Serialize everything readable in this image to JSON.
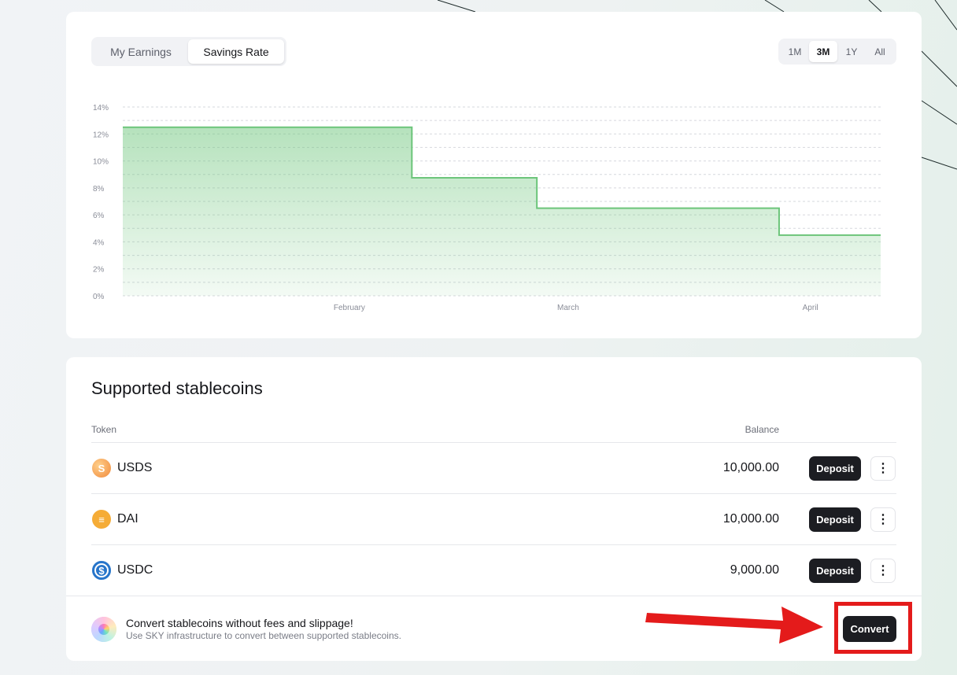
{
  "chart_tabs": {
    "earnings": "My Earnings",
    "savings_rate": "Savings Rate",
    "active": "savings_rate"
  },
  "ranges": [
    "1M",
    "3M",
    "1Y",
    "All"
  ],
  "active_range": "3M",
  "chart_data": {
    "type": "area",
    "step": true,
    "x": [
      "2025-01-03",
      "2025-02-09",
      "2025-02-25",
      "2025-03-28",
      "2025-04-10"
    ],
    "values": [
      12.5,
      8.75,
      6.5,
      4.5,
      4.5
    ],
    "x_ticks": [
      "February",
      "March",
      "April"
    ],
    "y_ticks": [
      "0%",
      "2%",
      "4%",
      "6%",
      "8%",
      "10%",
      "12%",
      "14%"
    ],
    "ylim": [
      0,
      14
    ],
    "grid": true,
    "color": "#6cc57a"
  },
  "stablecoins": {
    "title": "Supported stablecoins",
    "col_token": "Token",
    "col_balance": "Balance",
    "rows": [
      {
        "name": "USDS",
        "balance": "10,000.00",
        "icon": "usds-icon",
        "color": "#f0a14a"
      },
      {
        "name": "DAI",
        "balance": "10,000.00",
        "icon": "dai-icon",
        "color": "#f5ac37"
      },
      {
        "name": "USDC",
        "balance": "9,000.00",
        "icon": "usdc-icon",
        "color": "#2775ca"
      }
    ],
    "deposit_label": "Deposit",
    "more_label": "⋮"
  },
  "promo": {
    "title": "Convert stablecoins without fees and slippage!",
    "subtitle": "Use SKY infrastructure to convert between supported stablecoins.",
    "button": "Convert"
  }
}
